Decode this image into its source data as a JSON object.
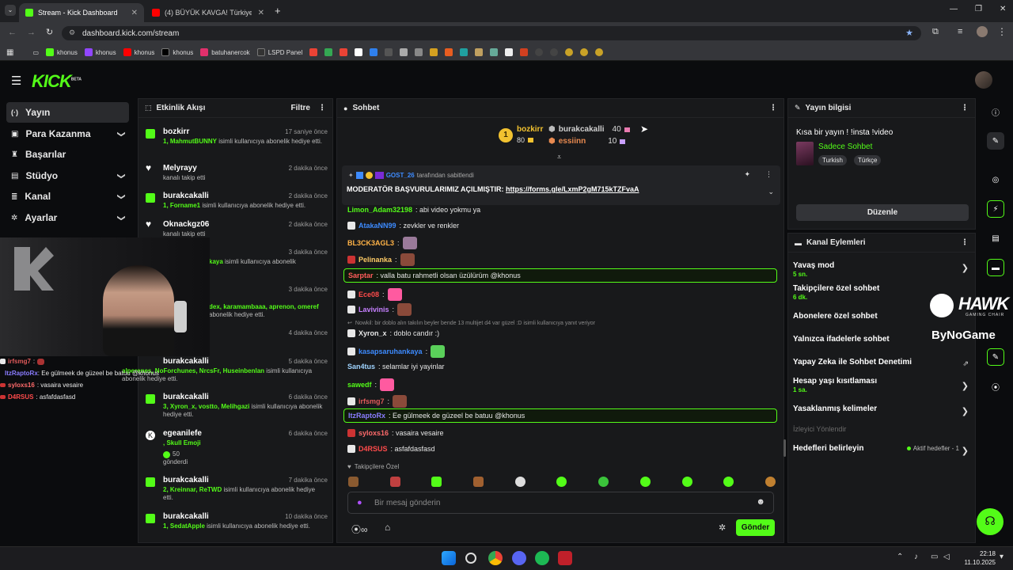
{
  "browser": {
    "tabs": [
      {
        "title": "Stream - Kick Dashboard"
      },
      {
        "title": "(4) BÜYÜK KAVGA! Türkiye'de Y"
      }
    ],
    "url": "dashboard.kick.com/stream",
    "bookmarks": [
      "khonus",
      "khonus",
      "khonus",
      "khonus",
      "batuhanercok",
      "LSPD Panel"
    ]
  },
  "brand": {
    "logo": "KICK",
    "beta": "BETA",
    "accent": "#53fc18"
  },
  "nav": [
    {
      "label": "Yayın",
      "icon": "broadcast-icon"
    },
    {
      "label": "Para Kazanma",
      "icon": "money-icon",
      "chev": "❯"
    },
    {
      "label": "Başarılar",
      "icon": "trophy-icon"
    },
    {
      "label": "Stüdyo",
      "icon": "studio-icon",
      "chev": "❯"
    },
    {
      "label": "Kanal",
      "icon": "channel-icon",
      "chev": "❯"
    },
    {
      "label": "Ayarlar",
      "icon": "gear-icon",
      "chev": "❯"
    }
  ],
  "activity": {
    "title": "Etkinlik Akışı",
    "filter": "Filtre",
    "items": [
      {
        "name": "bozkirr",
        "time": "17 saniye önce",
        "hl": "1, MahmutBUNNY",
        "desc": " isimli kullanıcıya abonelik hediye etti."
      },
      {
        "name": "Melyrayy",
        "time": "2 dakika önce",
        "hl": "",
        "desc": "kanalı takip etti"
      },
      {
        "name": "burakcakalli",
        "time": "2 dakika önce",
        "hl": "1, Forname1",
        "desc": " isimli kullanıcıya abonelik hediye etti."
      },
      {
        "name": "Oknackgz06",
        "time": "2 dakika önce",
        "hl": "",
        "desc": "kanalı takip etti"
      },
      {
        "name": "",
        "time": "3 dakika önce",
        "hl": "kaya",
        "desc": " isimli kullanıcıya abonelik"
      },
      {
        "name": "",
        "time": "3 dakika önce",
        "hl": "dex, karamambaaa, aprenon, omeref",
        "desc": " abonelik hediye etti."
      },
      {
        "name": "",
        "time": "4 dakika önce",
        "hl": "",
        "desc": ""
      },
      {
        "name": "burakcakalli",
        "time": "5 dakika önce",
        "hl": "alperenes, NoForchunes, NrcsFr, Huseinbenlan",
        "desc": " isimli kullanıcıya abonelik hediye etti."
      },
      {
        "name": "burakcakalli",
        "time": "6 dakika önce",
        "hl": "3, Xyron_x, vostto, Melihgazi",
        "desc": " isimli kullanıcıya abonelik hediye etti."
      },
      {
        "name": "egeanilefe",
        "time": "6 dakika önce",
        "hl": ", Skull Emoji",
        "desc": "",
        "amount": "50",
        "sent": "gönderdi"
      },
      {
        "name": "burakcakalli",
        "time": "7 dakika önce",
        "hl": "2, Kreinnar, ReTWD",
        "desc": " isimli kullanıcıya abonelik hediye etti."
      },
      {
        "name": "burakcakalli",
        "time": "10 dakika önce",
        "hl": "1, SedatApple",
        "desc": " isimli kullanıcıya abonelik hediye etti."
      }
    ]
  },
  "overlay_chat": [
    {
      "user": "irfsmg7",
      "text": ":",
      "color": "#e05a5a"
    },
    {
      "user": "ItzRaptoRx",
      "text": ": Ee gülmeek de güzeel be batuu @khonus",
      "color": "#8a7cff"
    },
    {
      "user": "syloxs16",
      "text": ": vasaira vesaire",
      "color": "#ff6b6b"
    },
    {
      "user": "D4RSUS",
      "text": ": asfafdasfasd",
      "color": "#ff4b4b"
    }
  ],
  "chat": {
    "title": "Sohbet",
    "leaderboard": [
      {
        "name": "bozkirr",
        "value": "80",
        "rank": "1"
      },
      {
        "name": "burakcakalli",
        "value": "40"
      },
      {
        "name": "essiinn",
        "value": "10"
      }
    ],
    "pinned_by": "GOST_26",
    "pinned_suffix": "tarafından sabitlendi",
    "pinned_text": "MODERATÖR BAŞVURULARIMIZ AÇILMIŞTIR: ",
    "pinned_link": "https://forms.gle/LxmP2gM715kTZFvaA",
    "messages": [
      {
        "user": "Limon_Adam32198",
        "text": ": abi video yokmu ya",
        "color": "#53fc18"
      },
      {
        "user": "AtakaNN99",
        "text": ": zevkler ve renkler",
        "color": "#3d8bff"
      },
      {
        "user": "BL3CK3AGL3",
        "text": ":",
        "color": "#ffb347"
      },
      {
        "user": "Pelinanka",
        "text": ":",
        "color": "#ffcc66"
      },
      {
        "user": "Sarptar",
        "text": ": valla batu rahmetli olsan üzülürüm @khonus",
        "color": "#ff5c5c"
      },
      {
        "user": "Ece08",
        "text": ":",
        "color": "#ff4b4b"
      },
      {
        "user": "Lavivinis",
        "text": ":",
        "color": "#c680ff"
      },
      {
        "user": "Xyron_x",
        "text": ": doblo candır :)",
        "color": "#e8e8e8"
      },
      {
        "user": "kasapsaruhankaya",
        "text": ":",
        "color": "#3d8bff"
      },
      {
        "user": "San4tus",
        "text": ": selamlar iyi yayinlar",
        "color": "#9fd4ff"
      },
      {
        "user": "sawedf",
        "text": ":",
        "color": "#53fc18"
      },
      {
        "user": "irfsmg7",
        "text": ":",
        "color": "#e05a5a"
      },
      {
        "user": "ItzRaptoRx",
        "text": ": Ee gülmeek de güzeel be batuu @khonus",
        "color": "#8a7cff"
      },
      {
        "user": "syloxs16",
        "text": ": vasaira vesaire",
        "color": "#ff6b6b"
      },
      {
        "user": "D4RSUS",
        "text": ": asfafdasfasd",
        "color": "#ff4b4b"
      }
    ],
    "reply_note": "Nowkil: bir doblo alın takılın beyler bende 13 multijet d4 var güzel :D isimli kullanıcıya yanıt veriyor",
    "followers_only": "Takipçilere Özel",
    "input_placeholder": "Bir mesaj gönderin",
    "send_label": "Gönder"
  },
  "stream_info": {
    "title": "Yayın bilgisi",
    "stream_title": "Kısa bir yayın ! !insta !video",
    "category": "Sadece Sohbet",
    "tags": [
      "Turkish",
      "Türkçe"
    ],
    "edit_label": "Düzenle"
  },
  "channel_actions": {
    "title": "Kanal Eylemleri",
    "items": [
      {
        "label": "Yavaş mod",
        "sub": "5 sn."
      },
      {
        "label": "Takipçilere özel sohbet",
        "sub": "6 dk."
      },
      {
        "label": "Abonelere özel sohbet",
        "sub": ""
      },
      {
        "label": "Yalnızca ifadelerle sohbet",
        "sub": ""
      },
      {
        "label": "Yapay Zeka ile Sohbet Denetimi",
        "sub": ""
      },
      {
        "label": "Hesap yaşı kısıtlaması",
        "sub": "1 sa."
      },
      {
        "label": "Yasaklanmış kelimeler",
        "sub": ""
      }
    ],
    "section_label": "İzleyici Yönlendir",
    "goals_label": "Hedefleri belirleyin",
    "goals_status": "Aktif hedefler - 1"
  },
  "sponsor": {
    "line1": "HAWK",
    "line2": "GAMING CHAIR",
    "line3": "ByNoGame"
  },
  "taskbar": {
    "time": "22:18",
    "date": "11.10.2025"
  }
}
